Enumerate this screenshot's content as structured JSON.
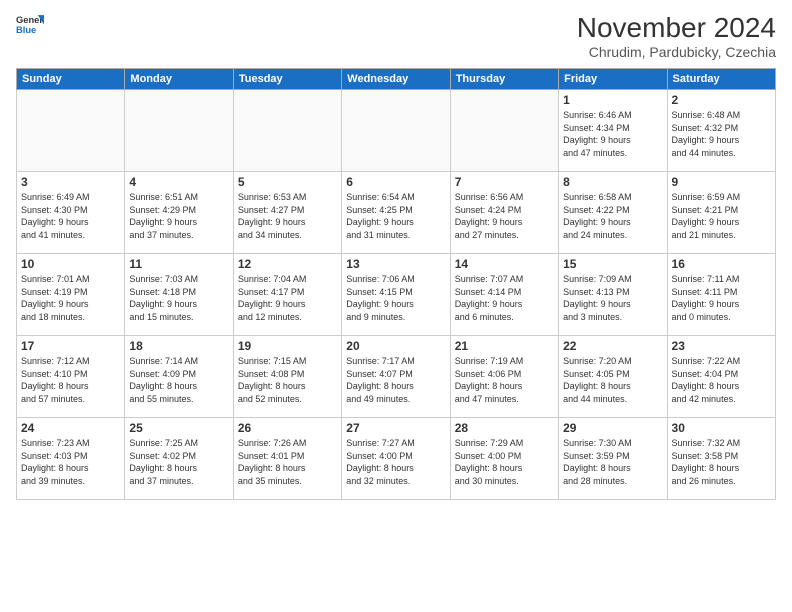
{
  "header": {
    "logo_general": "General",
    "logo_blue": "Blue",
    "month_title": "November 2024",
    "subtitle": "Chrudim, Pardubicky, Czechia"
  },
  "weekdays": [
    "Sunday",
    "Monday",
    "Tuesday",
    "Wednesday",
    "Thursday",
    "Friday",
    "Saturday"
  ],
  "weeks": [
    [
      {
        "day": "",
        "info": ""
      },
      {
        "day": "",
        "info": ""
      },
      {
        "day": "",
        "info": ""
      },
      {
        "day": "",
        "info": ""
      },
      {
        "day": "",
        "info": ""
      },
      {
        "day": "1",
        "info": "Sunrise: 6:46 AM\nSunset: 4:34 PM\nDaylight: 9 hours\nand 47 minutes."
      },
      {
        "day": "2",
        "info": "Sunrise: 6:48 AM\nSunset: 4:32 PM\nDaylight: 9 hours\nand 44 minutes."
      }
    ],
    [
      {
        "day": "3",
        "info": "Sunrise: 6:49 AM\nSunset: 4:30 PM\nDaylight: 9 hours\nand 41 minutes."
      },
      {
        "day": "4",
        "info": "Sunrise: 6:51 AM\nSunset: 4:29 PM\nDaylight: 9 hours\nand 37 minutes."
      },
      {
        "day": "5",
        "info": "Sunrise: 6:53 AM\nSunset: 4:27 PM\nDaylight: 9 hours\nand 34 minutes."
      },
      {
        "day": "6",
        "info": "Sunrise: 6:54 AM\nSunset: 4:25 PM\nDaylight: 9 hours\nand 31 minutes."
      },
      {
        "day": "7",
        "info": "Sunrise: 6:56 AM\nSunset: 4:24 PM\nDaylight: 9 hours\nand 27 minutes."
      },
      {
        "day": "8",
        "info": "Sunrise: 6:58 AM\nSunset: 4:22 PM\nDaylight: 9 hours\nand 24 minutes."
      },
      {
        "day": "9",
        "info": "Sunrise: 6:59 AM\nSunset: 4:21 PM\nDaylight: 9 hours\nand 21 minutes."
      }
    ],
    [
      {
        "day": "10",
        "info": "Sunrise: 7:01 AM\nSunset: 4:19 PM\nDaylight: 9 hours\nand 18 minutes."
      },
      {
        "day": "11",
        "info": "Sunrise: 7:03 AM\nSunset: 4:18 PM\nDaylight: 9 hours\nand 15 minutes."
      },
      {
        "day": "12",
        "info": "Sunrise: 7:04 AM\nSunset: 4:17 PM\nDaylight: 9 hours\nand 12 minutes."
      },
      {
        "day": "13",
        "info": "Sunrise: 7:06 AM\nSunset: 4:15 PM\nDaylight: 9 hours\nand 9 minutes."
      },
      {
        "day": "14",
        "info": "Sunrise: 7:07 AM\nSunset: 4:14 PM\nDaylight: 9 hours\nand 6 minutes."
      },
      {
        "day": "15",
        "info": "Sunrise: 7:09 AM\nSunset: 4:13 PM\nDaylight: 9 hours\nand 3 minutes."
      },
      {
        "day": "16",
        "info": "Sunrise: 7:11 AM\nSunset: 4:11 PM\nDaylight: 9 hours\nand 0 minutes."
      }
    ],
    [
      {
        "day": "17",
        "info": "Sunrise: 7:12 AM\nSunset: 4:10 PM\nDaylight: 8 hours\nand 57 minutes."
      },
      {
        "day": "18",
        "info": "Sunrise: 7:14 AM\nSunset: 4:09 PM\nDaylight: 8 hours\nand 55 minutes."
      },
      {
        "day": "19",
        "info": "Sunrise: 7:15 AM\nSunset: 4:08 PM\nDaylight: 8 hours\nand 52 minutes."
      },
      {
        "day": "20",
        "info": "Sunrise: 7:17 AM\nSunset: 4:07 PM\nDaylight: 8 hours\nand 49 minutes."
      },
      {
        "day": "21",
        "info": "Sunrise: 7:19 AM\nSunset: 4:06 PM\nDaylight: 8 hours\nand 47 minutes."
      },
      {
        "day": "22",
        "info": "Sunrise: 7:20 AM\nSunset: 4:05 PM\nDaylight: 8 hours\nand 44 minutes."
      },
      {
        "day": "23",
        "info": "Sunrise: 7:22 AM\nSunset: 4:04 PM\nDaylight: 8 hours\nand 42 minutes."
      }
    ],
    [
      {
        "day": "24",
        "info": "Sunrise: 7:23 AM\nSunset: 4:03 PM\nDaylight: 8 hours\nand 39 minutes."
      },
      {
        "day": "25",
        "info": "Sunrise: 7:25 AM\nSunset: 4:02 PM\nDaylight: 8 hours\nand 37 minutes."
      },
      {
        "day": "26",
        "info": "Sunrise: 7:26 AM\nSunset: 4:01 PM\nDaylight: 8 hours\nand 35 minutes."
      },
      {
        "day": "27",
        "info": "Sunrise: 7:27 AM\nSunset: 4:00 PM\nDaylight: 8 hours\nand 32 minutes."
      },
      {
        "day": "28",
        "info": "Sunrise: 7:29 AM\nSunset: 4:00 PM\nDaylight: 8 hours\nand 30 minutes."
      },
      {
        "day": "29",
        "info": "Sunrise: 7:30 AM\nSunset: 3:59 PM\nDaylight: 8 hours\nand 28 minutes."
      },
      {
        "day": "30",
        "info": "Sunrise: 7:32 AM\nSunset: 3:58 PM\nDaylight: 8 hours\nand 26 minutes."
      }
    ]
  ]
}
